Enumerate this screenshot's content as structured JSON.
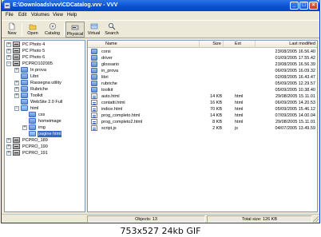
{
  "window": {
    "title": "E:\\Downloads\\vvv\\CDCatalog.vvv - VVV",
    "minimize": "_",
    "maximize": "□",
    "close": "×"
  },
  "menu": [
    "File",
    "Edit",
    "Volumes",
    "View",
    "Help"
  ],
  "toolbar": [
    {
      "label": "New",
      "icon": "new-document-icon",
      "active": false
    },
    {
      "label": "Open",
      "icon": "open-folder-icon",
      "active": false
    },
    {
      "label": "Catalog",
      "icon": "catalog-icon",
      "active": false
    },
    {
      "label": "Physical",
      "icon": "physical-view-icon",
      "active": true
    },
    {
      "label": "Virtual",
      "icon": "virtual-view-icon",
      "active": false
    },
    {
      "label": "Search",
      "icon": "search-icon",
      "active": false
    }
  ],
  "tree": [
    {
      "label": "PC Photo 4",
      "level": 0,
      "type": "volume",
      "expander": "+"
    },
    {
      "label": "PC Photo 5",
      "level": 0,
      "type": "volume",
      "expander": "+"
    },
    {
      "label": "PC Photo 6",
      "level": 0,
      "type": "volume",
      "expander": "+"
    },
    {
      "label": "PCPRO102005",
      "level": 0,
      "type": "volume",
      "expander": "−"
    },
    {
      "label": "In prova",
      "level": 1,
      "type": "folder",
      "expander": "+"
    },
    {
      "label": "Libri",
      "level": 1,
      "type": "folder",
      "expander": ""
    },
    {
      "label": "Rassegna utility",
      "level": 1,
      "type": "folder",
      "expander": "+"
    },
    {
      "label": "Rubriche",
      "level": 1,
      "type": "folder",
      "expander": "+"
    },
    {
      "label": "Toolkit",
      "level": 1,
      "type": "folder",
      "expander": "+"
    },
    {
      "label": "WebSite 2.0 Full",
      "level": 1,
      "type": "folder",
      "expander": ""
    },
    {
      "label": "html",
      "level": 1,
      "type": "folder-open",
      "expander": "−"
    },
    {
      "label": "css",
      "level": 2,
      "type": "folder",
      "expander": ""
    },
    {
      "label": "homeimage",
      "level": 2,
      "type": "folder",
      "expander": ""
    },
    {
      "label": "img",
      "level": 2,
      "type": "folder",
      "expander": "+"
    },
    {
      "label": "pagine html",
      "level": 2,
      "type": "folder-open",
      "expander": "",
      "selected": true
    },
    {
      "label": "PCPRO_189",
      "level": 0,
      "type": "volume",
      "expander": "+"
    },
    {
      "label": "PCPRO_190",
      "level": 0,
      "type": "volume",
      "expander": "+"
    },
    {
      "label": "PCPRO_191",
      "level": 0,
      "type": "volume",
      "expander": "+"
    }
  ],
  "list": {
    "columns": [
      "Name",
      "Size",
      "Ext",
      "Last modified"
    ],
    "rows": [
      {
        "name": "corsi",
        "size": "",
        "ext": "",
        "modified": "23/08/2005 16.56.40",
        "folder": true
      },
      {
        "name": "driver",
        "size": "",
        "ext": "",
        "modified": "01/09/2005 17.55.42",
        "folder": true
      },
      {
        "name": "glossario",
        "size": "",
        "ext": "",
        "modified": "23/08/2005 16.56.39",
        "folder": true
      },
      {
        "name": "in_prova",
        "size": "",
        "ext": "",
        "modified": "06/09/2005 16.09.32",
        "folder": true
      },
      {
        "name": "libri",
        "size": "",
        "ext": "",
        "modified": "02/08/2005 16.43.47",
        "folder": true
      },
      {
        "name": "rubriche",
        "size": "",
        "ext": "",
        "modified": "05/09/2005 12.29.57",
        "folder": true
      },
      {
        "name": "toolkit",
        "size": "",
        "ext": "",
        "modified": "05/09/2005 10.38.40",
        "folder": true
      },
      {
        "name": "auto.html",
        "size": "14 KB",
        "ext": "html",
        "modified": "29/08/2005 15.11.01",
        "folder": false
      },
      {
        "name": "contatti.html",
        "size": "16 KB",
        "ext": "html",
        "modified": "06/09/2005 14.20.53",
        "folder": false
      },
      {
        "name": "indice.html",
        "size": "70 KB",
        "ext": "html",
        "modified": "05/09/2005 15.46.12",
        "folder": false
      },
      {
        "name": "prog_completo.html",
        "size": "14 KB",
        "ext": "html",
        "modified": "07/09/2005 14.00.04",
        "folder": false
      },
      {
        "name": "prog_completo2.html",
        "size": "8 KB",
        "ext": "html",
        "modified": "29/08/2005 15.11.01",
        "folder": false
      },
      {
        "name": "script.js",
        "size": "2 KB",
        "ext": "js",
        "modified": "04/07/2005 13.49.59",
        "folder": false
      }
    ]
  },
  "status": {
    "objects": "Objects: 13",
    "total_size": "Total size: 126 KB"
  },
  "footer": "753x527 24kb GIF"
}
